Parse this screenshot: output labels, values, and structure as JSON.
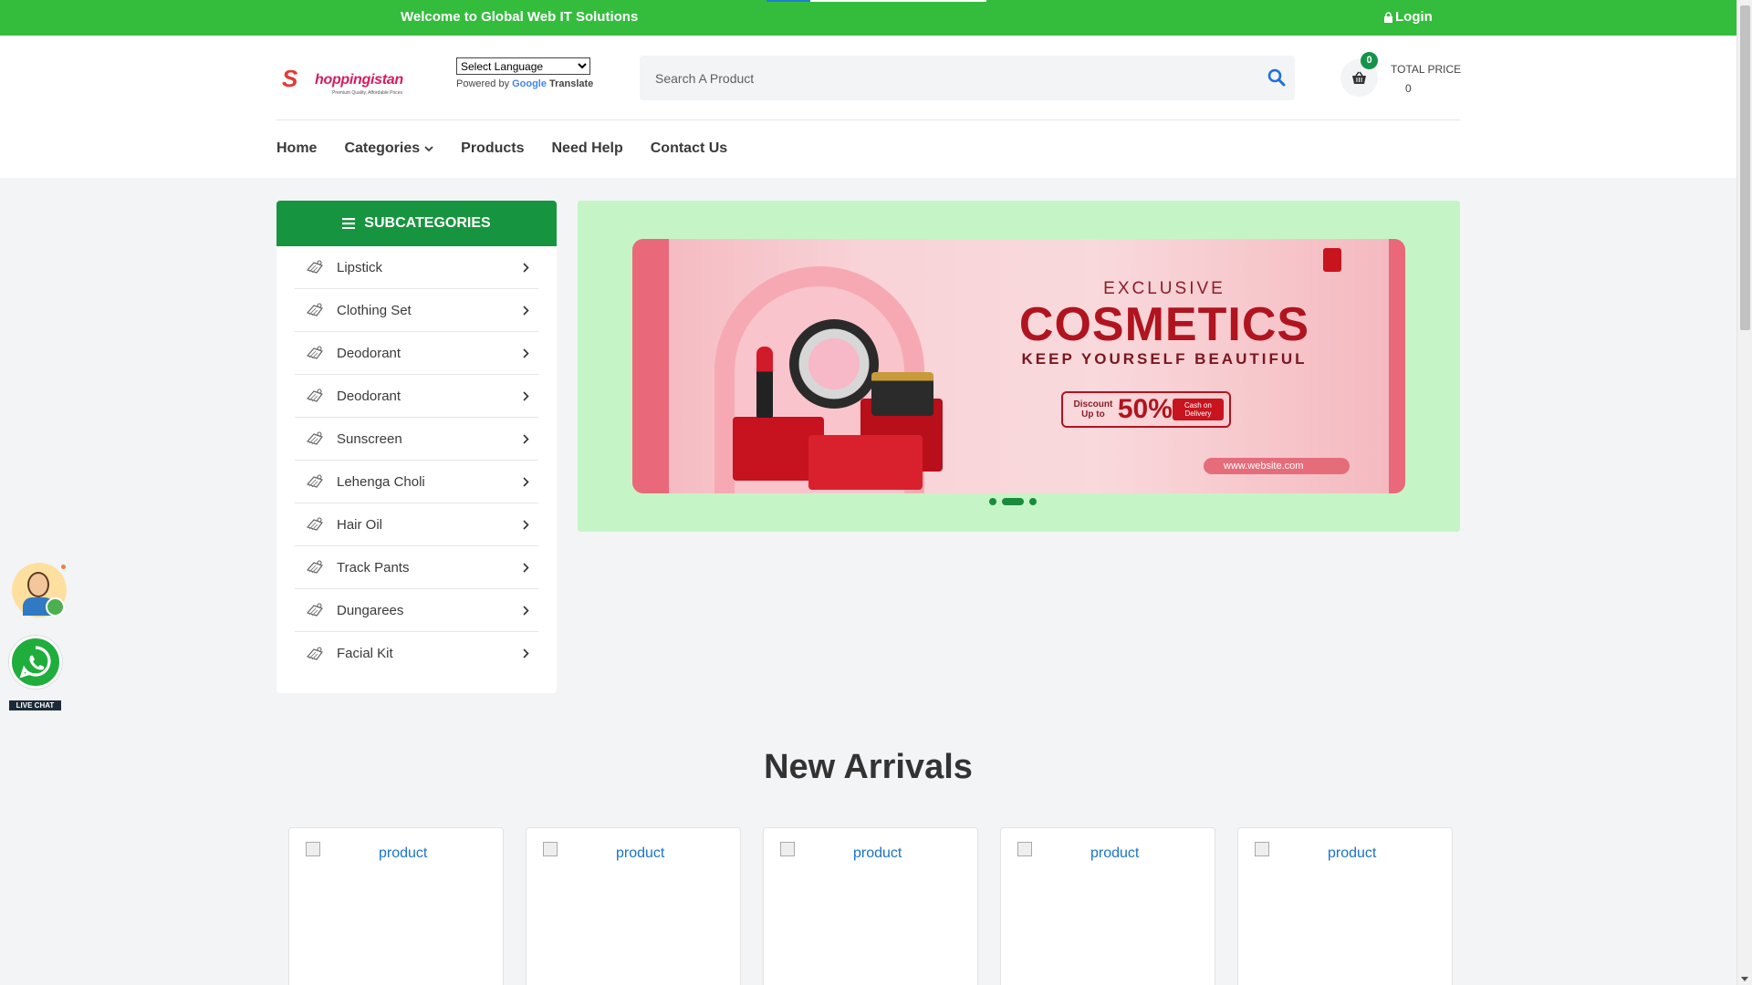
{
  "topbar": {
    "welcome": "Welcome to Global Web IT Solutions",
    "login": "Login"
  },
  "header": {
    "logo": {
      "name": "hoppingistan",
      "tagline": "Premium Quality, Affordable Prices"
    },
    "language": {
      "selected": "Select Language",
      "powered_by": "Powered by",
      "google": "Google",
      "translate": "Translate"
    },
    "search": {
      "placeholder": "Search A Product"
    },
    "cart": {
      "count": "0",
      "total_label": "TOTAL PRICE",
      "total_value": "0"
    }
  },
  "nav": [
    {
      "label": "Home"
    },
    {
      "label": "Categories"
    },
    {
      "label": "Products"
    },
    {
      "label": "Need Help"
    },
    {
      "label": "Contact Us"
    }
  ],
  "sidebar": {
    "title": "SUBCATEGORIES",
    "items": [
      {
        "label": "Lipstick"
      },
      {
        "label": "Clothing Set"
      },
      {
        "label": "Deodorant"
      },
      {
        "label": "Deodorant"
      },
      {
        "label": "Sunscreen"
      },
      {
        "label": "Lehenga Choli"
      },
      {
        "label": "Hair Oil"
      },
      {
        "label": "Track Pants"
      },
      {
        "label": "Dungarees"
      },
      {
        "label": "Facial Kit"
      }
    ]
  },
  "banner": {
    "exclusive": "EXCLUSIVE",
    "headline": "COSMETICS",
    "tagline": "KEEP YOURSELF BEAUTIFUL",
    "discount_label": "Discount Up to",
    "discount_value": "50%",
    "cod": "Cash on Delivery",
    "website": "www.website.com",
    "slides_count": 3,
    "active_slide": 2
  },
  "new_arrivals": {
    "title": "New Arrivals",
    "products": [
      {
        "alt": "product"
      },
      {
        "alt": "product"
      },
      {
        "alt": "product"
      },
      {
        "alt": "product"
      },
      {
        "alt": "product"
      }
    ]
  },
  "widgets": {
    "live_chat": "LIVE CHAT"
  },
  "colors": {
    "topbar": "#34bd3d",
    "primary_green": "#17943f",
    "banner_bg": "#c5f5c6",
    "link_blue": "#1a73c9"
  },
  "icons": [
    "lock-icon",
    "search-icon",
    "basket-icon",
    "chevron-down-icon",
    "menu-icon",
    "category-icon",
    "chevron-right-icon",
    "whatsapp-icon"
  ]
}
